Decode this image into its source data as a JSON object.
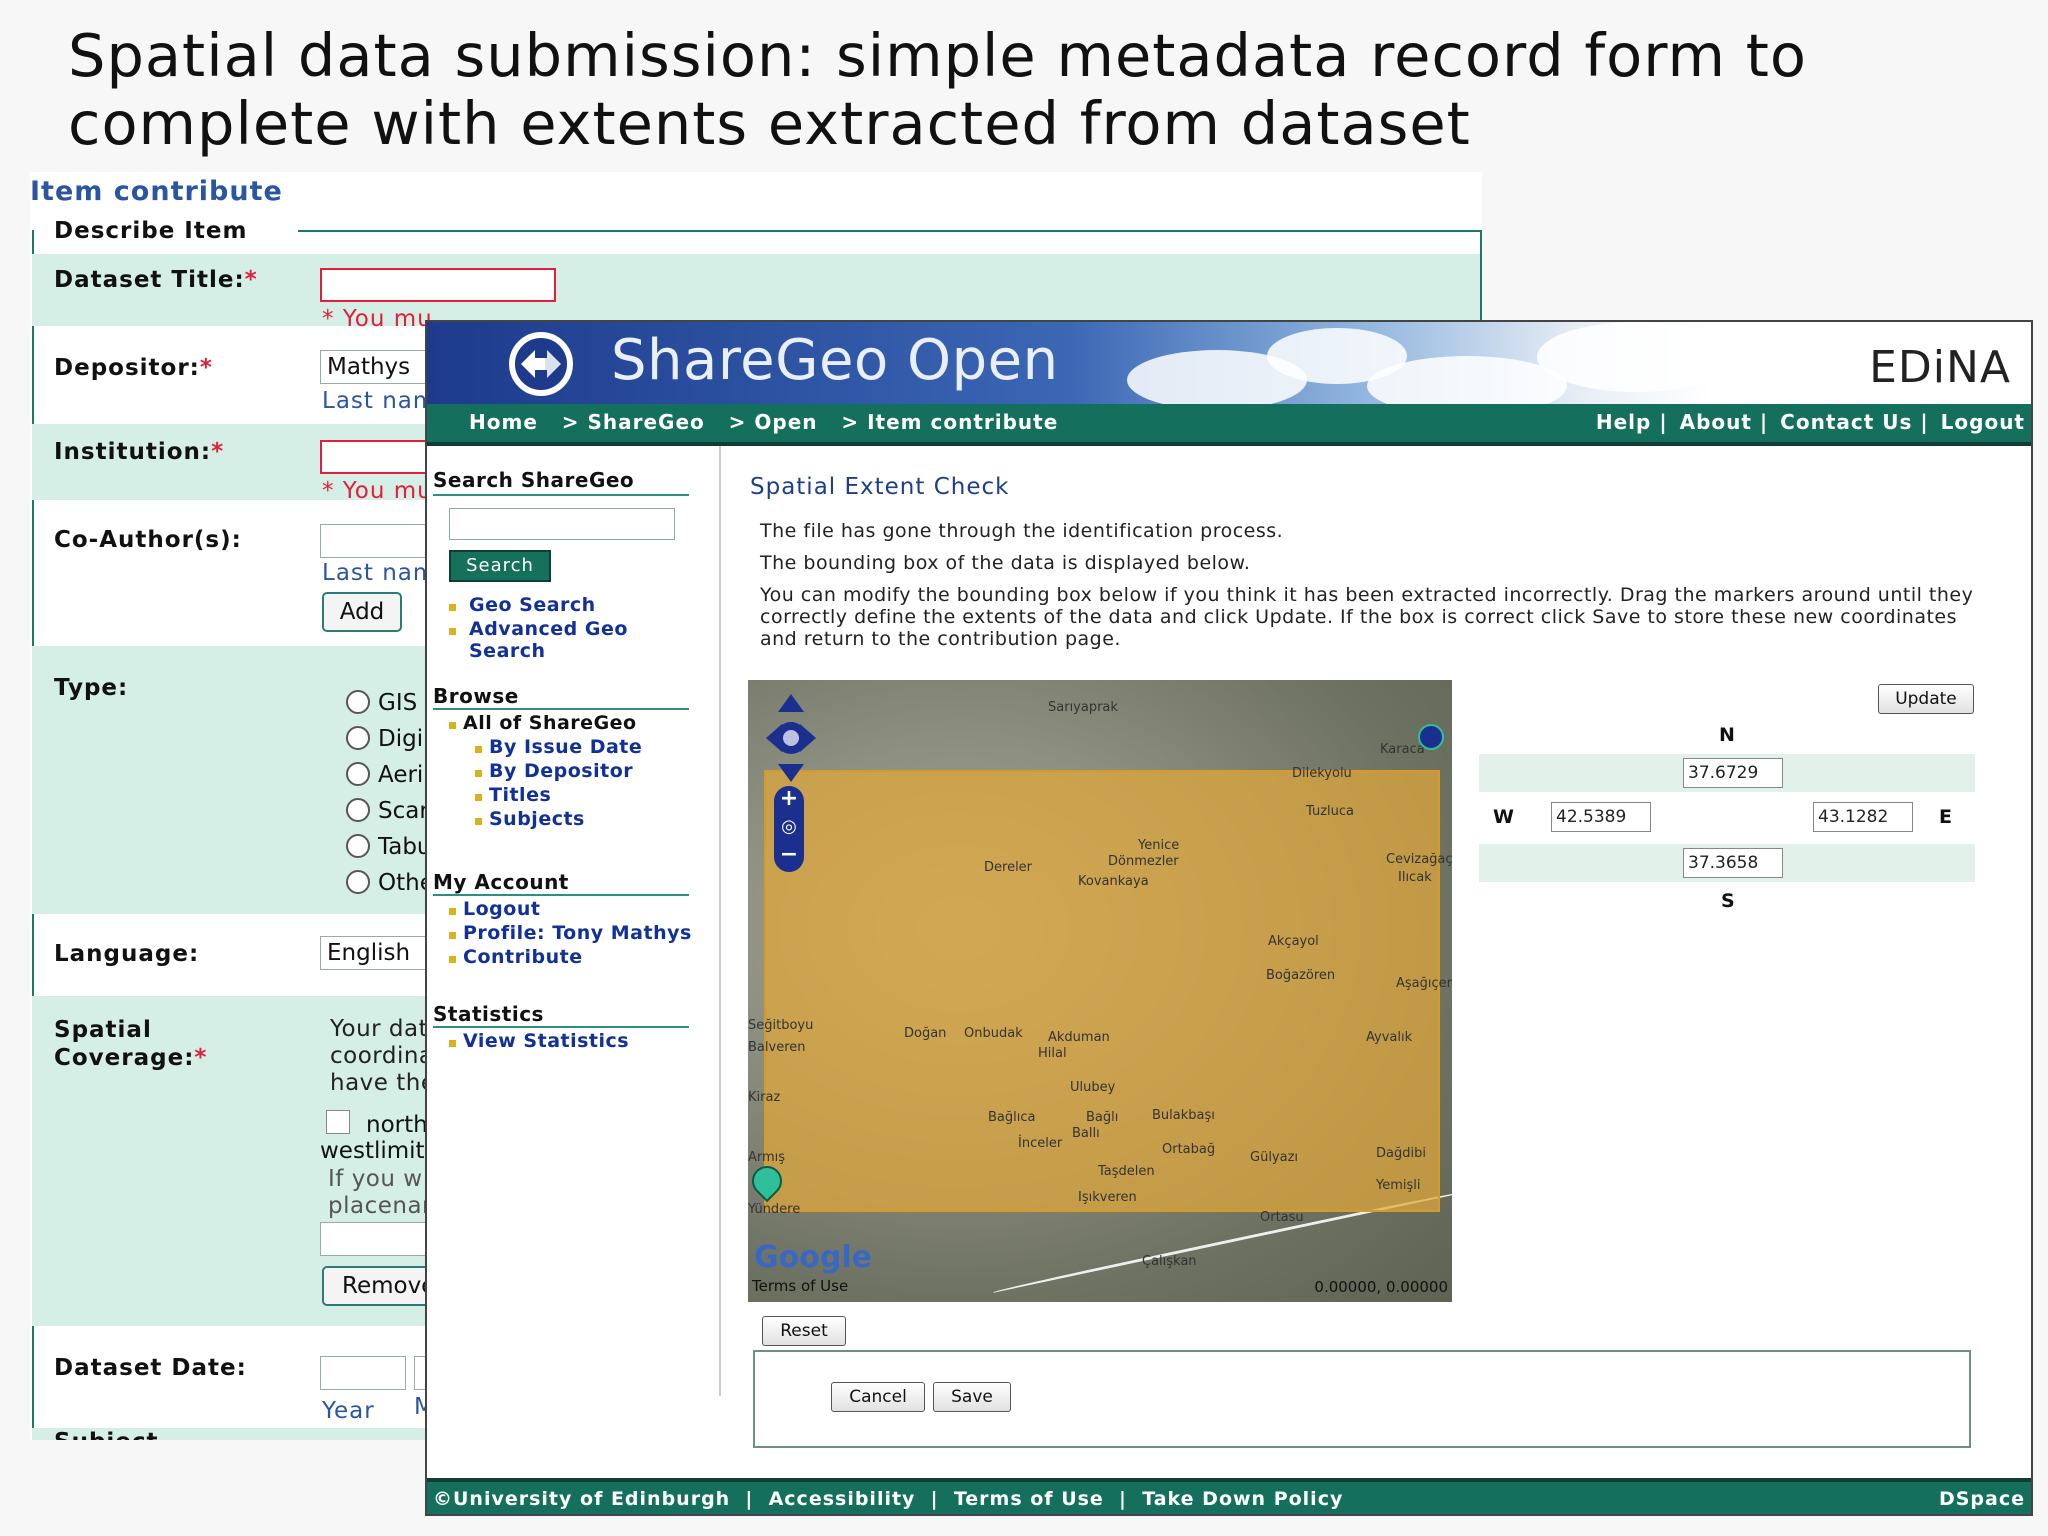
{
  "slide": {
    "title": "Spatial data submission: simple metadata record form to complete with extents extracted from dataset"
  },
  "back_form": {
    "heading": "Item contribute",
    "tab": "Describe Item",
    "required_mark": "*",
    "dataset_title": {
      "label": "Dataset Title:",
      "error": "* You mu"
    },
    "depositor": {
      "label": "Depositor:",
      "value": "Mathys",
      "hint": "Last nam"
    },
    "institution": {
      "label": "Institution:",
      "error": "* You mu"
    },
    "coauthors": {
      "label": "Co-Author(s):",
      "hint": "Last nam",
      "add_label": "Add"
    },
    "type": {
      "label": "Type:",
      "options": [
        "GIS",
        "Digi",
        "Aeri",
        "Scar",
        "Tabu",
        "Othe"
      ]
    },
    "language": {
      "label": "Language:",
      "value": "English"
    },
    "spatial": {
      "label_line1": "Spatial",
      "label_line2": "Coverage:",
      "text_line1": "Your dat",
      "text_line2": "coordina",
      "text_line3": "have the",
      "check_label": "north",
      "westlimit": "westlimit",
      "gray_line1": "If you w",
      "gray_line2": "placenar",
      "remove_label": "Remove"
    },
    "dataset_date": {
      "label": "Dataset Date:",
      "year_hint": "Year",
      "month_hint": "M"
    },
    "subject_label": "Subject"
  },
  "sharegeo": {
    "logo_text": "ShareGeo Open",
    "edina_logo": "EDiNA",
    "breadcrumb": "Home   > ShareGeo   > Open   > Item contribute",
    "nav_right": [
      "Help",
      "About",
      "Contact Us",
      "Logout"
    ],
    "sidebar": {
      "search_heading": "Search ShareGeo",
      "search_button": "Search",
      "search_links": [
        "Geo Search",
        "Advanced Geo",
        "Search"
      ],
      "browse_heading": "Browse",
      "browse_all": "All of ShareGeo",
      "browse_items": [
        "By Issue Date",
        "By Depositor",
        "Titles",
        "Subjects"
      ],
      "account_heading": "My Account",
      "account_items": [
        "Logout",
        "Profile: Tony Mathys",
        "Contribute"
      ],
      "stats_heading": "Statistics",
      "stats_items": [
        "View Statistics"
      ]
    },
    "main": {
      "title": "Spatial Extent Check",
      "para1": "The file has gone through the identification process.",
      "para2": "The bounding box of the data is displayed below.",
      "para3": "You can modify the bounding box below if you think it has been extracted incorrectly. Drag the markers around until they correctly define the extents of the data and click Update. If the box is correct click Save to store these new coordinates and return to the contribution page."
    },
    "map": {
      "place_names": [
        "Sarıyaprak",
        "Karaca",
        "Dilekyolu",
        "Tuzluca",
        "Yenice",
        "Dönmezler",
        "Dereler",
        "Kovankaya",
        "Cevizağaç",
        "Ilıcak",
        "Akçayol",
        "Boğazören",
        "Aşağıçer",
        "Seğitboyu",
        "Balveren",
        "Doğan",
        "Onbudak",
        "Akduman",
        "Ayvalık",
        "Hilal",
        "Ulubey",
        "Bağlıca",
        "Bağlı",
        "Bulakbaşı",
        "Ballı",
        "İnceler",
        "Ortabağ",
        "Gülyazı",
        "Dağdibi",
        "Taşdelen",
        "Yemişli",
        "Işıkveren",
        "Ortasu",
        "Çalışkan",
        "Kiraz",
        "Armış",
        "Yündere"
      ],
      "google_label": "Google",
      "terms_label": "Terms of Use",
      "coords_readout": "0.00000, 0.00000"
    },
    "extent": {
      "update_label": "Update",
      "north_label": "N",
      "south_label": "S",
      "west_label": "W",
      "east_label": "E",
      "north": "37.6729",
      "south": "37.3658",
      "west": "42.5389",
      "east": "43.1282"
    },
    "reset_label": "Reset",
    "cancel_label": "Cancel",
    "save_label": "Save",
    "footer_left": "©University of Edinburgh  |  Accessibility  |  Terms of Use  |  Take Down Policy",
    "footer_right": "DSpace"
  }
}
